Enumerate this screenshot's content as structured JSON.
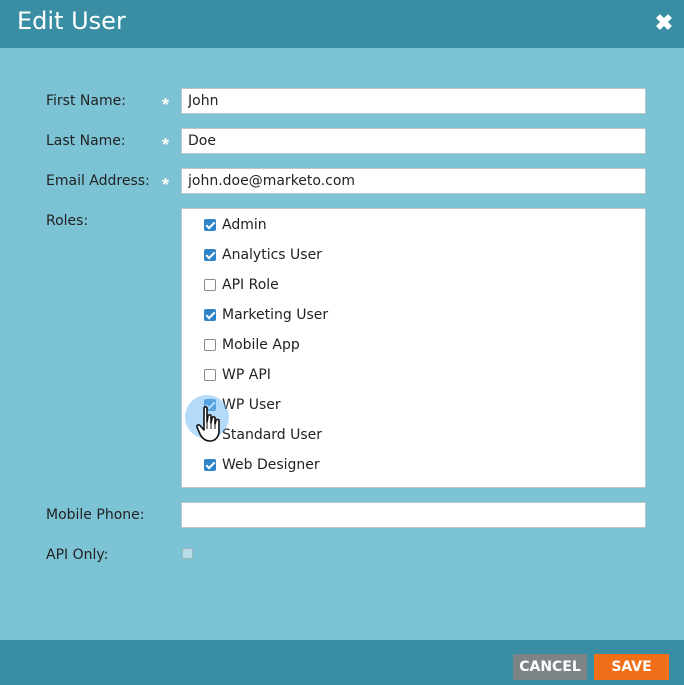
{
  "dialog": {
    "title": "Edit User",
    "close_icon": "close-icon",
    "close_glyph": "✖"
  },
  "form": {
    "first_name": {
      "label": "First Name:",
      "value": "John",
      "required_marker": "*"
    },
    "last_name": {
      "label": "Last Name:",
      "value": "Doe",
      "required_marker": "*"
    },
    "email": {
      "label": "Email Address:",
      "value": "john.doe@marketo.com",
      "required_marker": "*"
    },
    "roles": {
      "label": "Roles:",
      "items": [
        {
          "label": "Admin",
          "checked": true
        },
        {
          "label": "Analytics User",
          "checked": true
        },
        {
          "label": "API Role",
          "checked": false
        },
        {
          "label": "Marketing User",
          "checked": true
        },
        {
          "label": "Mobile App",
          "checked": false
        },
        {
          "label": "WP API",
          "checked": false
        },
        {
          "label": "WP User",
          "checked": true
        },
        {
          "label": "Standard User",
          "checked": false
        },
        {
          "label": "Web Designer",
          "checked": true
        }
      ]
    },
    "mobile_phone": {
      "label": "Mobile Phone:",
      "value": ""
    },
    "api_only": {
      "label": "API Only:",
      "checked": false
    }
  },
  "footer": {
    "cancel_label": "CANCEL",
    "save_label": "SAVE"
  },
  "colors": {
    "header_bg": "#3a8ea3",
    "body_bg": "#7cc3d5",
    "checkbox_accent": "#2f84c9",
    "save_button": "#f26f1a",
    "cancel_button": "#7c8488"
  }
}
